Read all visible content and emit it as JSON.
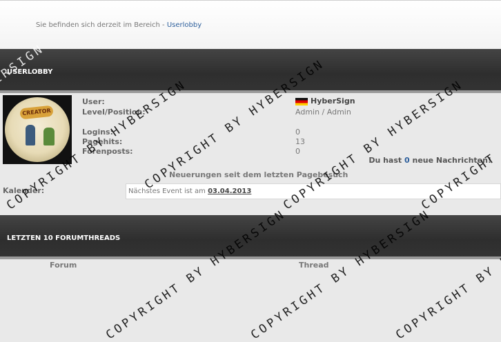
{
  "breadcrumb": {
    "prefix": "Sie befinden sich derzeit im Bereich - ",
    "link": "Userlobby"
  },
  "sections": {
    "userlobby": "USERLOBBY",
    "threads": "LETZTEN 10 FORUMTHREADS"
  },
  "avatar": {
    "badge_text": "CREATOR"
  },
  "profile": {
    "user_label": "User:",
    "level_label": "Level/Position:",
    "logins_label": "Logins:",
    "pagehits_label": "Pagehits:",
    "forenposts_label": "Forenposts:",
    "username": "HyberSign",
    "level_value": "Admin / Admin",
    "logins_value": "0",
    "pagehits_value": "13",
    "forenposts_value": "0"
  },
  "messages": {
    "prefix": "Du hast ",
    "count": "0",
    "suffix": " neue Nachrichten!"
  },
  "changes_text": "Neuerungen seit dem letzten Pagebesuch",
  "calendar": {
    "label": "Kalender:",
    "text": "Nächstes Event ist am ",
    "date": "03.04.2013"
  },
  "thread_table": {
    "col_forum": "Forum",
    "col_thread": "Thread"
  },
  "watermark": "COPYRIGHT BY HYBERSIGN",
  "colors": {
    "link": "#2d5f9c",
    "bar": "#333333",
    "background": "#e9e9e9"
  }
}
